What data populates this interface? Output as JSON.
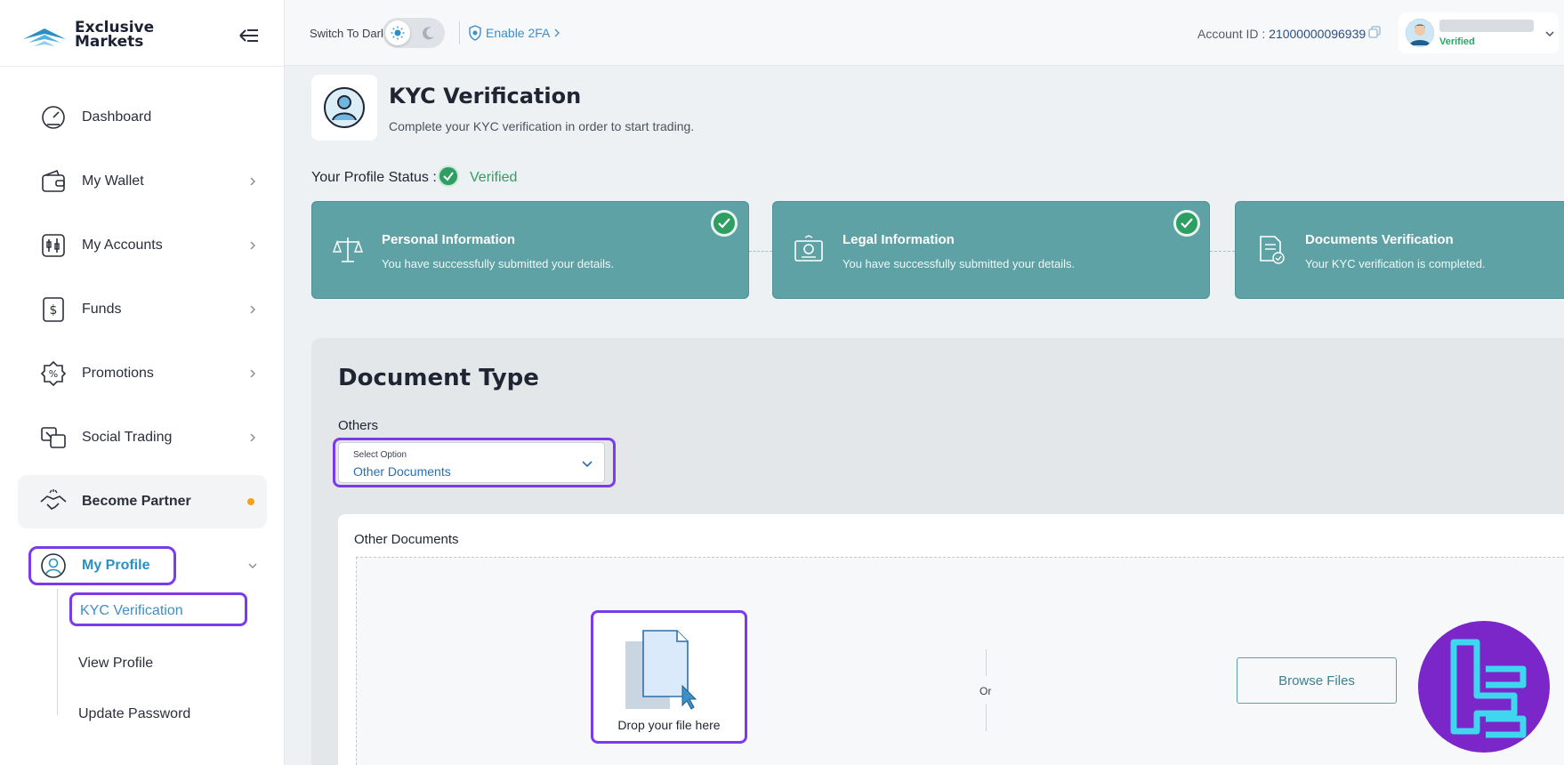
{
  "brand": {
    "line1": "Exclusive",
    "line2": "Markets"
  },
  "sidebar": {
    "items": [
      {
        "label": "Dashboard",
        "icon": "dashboard-gauge-icon"
      },
      {
        "label": "My Wallet",
        "icon": "wallet-icon"
      },
      {
        "label": "My Accounts",
        "icon": "accounts-icon"
      },
      {
        "label": "Funds",
        "icon": "funds-dollar-icon"
      },
      {
        "label": "Promotions",
        "icon": "promotion-badge-icon"
      },
      {
        "label": "Social Trading",
        "icon": "social-trading-icon"
      },
      {
        "label": "Become Partner",
        "icon": "handshake-icon"
      },
      {
        "label": "My Profile",
        "icon": "profile-icon"
      }
    ],
    "profile_sub": [
      "KYC Verification",
      "View Profile",
      "Update Password"
    ]
  },
  "header": {
    "switch_label": "Switch To Dark",
    "twofa_label": "Enable 2FA",
    "account_label": "Account ID :",
    "account_id": "21000000096939",
    "user_status": "Verified"
  },
  "kyc": {
    "title": "KYC Verification",
    "subtitle": "Complete your KYC verification in order to start trading.",
    "status_label": "Your Profile Status :",
    "status_value": "Verified"
  },
  "steps": [
    {
      "title": "Personal Information",
      "desc": "You have successfully submitted your details."
    },
    {
      "title": "Legal Information",
      "desc": "You have successfully submitted your details."
    },
    {
      "title": "Documents Verification",
      "desc": "Your KYC verification is completed."
    }
  ],
  "document": {
    "title": "Document Type",
    "group_label": "Others",
    "select_small": "Select Option",
    "select_value": "Other Documents",
    "upload_label": "Other Documents",
    "drop_text": "Drop your file here",
    "or_text": "Or",
    "browse_label": "Browse Files"
  },
  "colors": {
    "accent": "#2b8fc4",
    "teal": "#5ea2a5",
    "highlight": "#7c3aed",
    "success": "#2f9e62"
  }
}
